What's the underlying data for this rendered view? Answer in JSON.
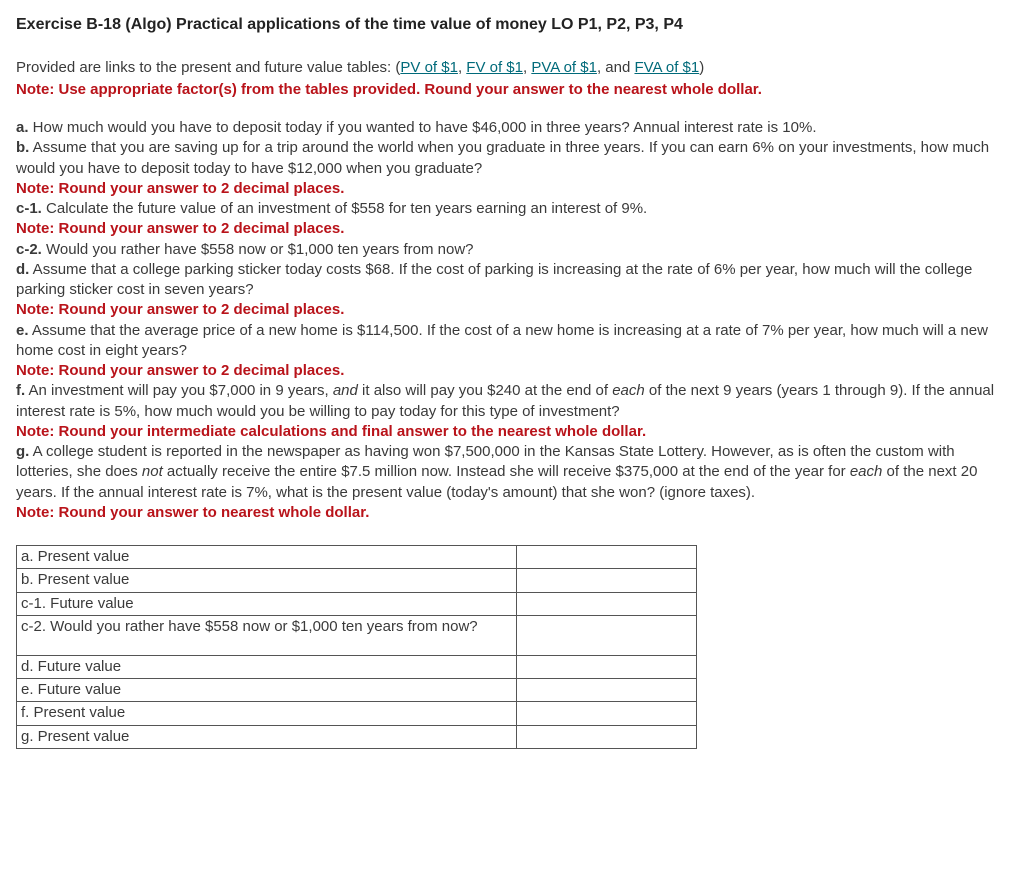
{
  "title": "Exercise B-18 (Algo) Practical applications of the time value of money LO P1, P2, P3, P4",
  "intro": {
    "lead": "Provided are links to the present and future value tables: (",
    "links": {
      "pv": "PV of $1",
      "fv": "FV of $1",
      "pva": "PVA of $1",
      "fva": "FVA of $1"
    },
    "tail": ")"
  },
  "main_note": "Note: Use appropriate factor(s) from the tables provided. Round your answer to the nearest whole dollar.",
  "questions": {
    "a": {
      "label": "a.",
      "text": " How much would you have to deposit today if you wanted to have $46,000 in three years? Annual interest rate is 10%."
    },
    "b": {
      "label": "b.",
      "text": " Assume that you are saving up for a trip around the world when you graduate in three years. If you can earn 6% on your investments, how much would you have to deposit today to have $12,000 when you graduate?",
      "note": "Note: Round your answer to 2 decimal places."
    },
    "c1": {
      "label": "c-1.",
      "text": " Calculate the future value of an investment of $558 for ten years earning an interest of 9%.",
      "note": "Note: Round your answer to 2 decimal places."
    },
    "c2": {
      "label": "c-2.",
      "text": " Would you rather have $558 now or $1,000 ten years from now?"
    },
    "d": {
      "label": "d.",
      "text": " Assume that a college parking sticker today costs $68. If the cost of parking is increasing at the rate of 6% per year, how much will the college parking sticker cost in seven years?",
      "note": "Note: Round your answer to 2 decimal places."
    },
    "e": {
      "label": "e.",
      "text": " Assume that the average price of a new home is $114,500. If the cost of a new home is increasing at a rate of 7% per year, how much will a new home cost in eight years?",
      "note": "Note: Round your answer to 2 decimal places."
    },
    "f": {
      "label": "f.",
      "text_a": " An investment will pay you $7,000 in 9 years, ",
      "em1": "and",
      "text_b": " it also will pay you $240 at the end of ",
      "em2": "each",
      "text_c": " of the next 9 years (years 1 through 9). If the annual interest rate is 5%, how much would you be willing to pay today for this type of investment?",
      "note": "Note: Round your intermediate calculations and final answer to the nearest whole dollar."
    },
    "g": {
      "label": "g.",
      "text_a": " A college student is reported in the newspaper as having won $7,500,000 in the Kansas State Lottery. However, as is often the custom with lotteries, she does ",
      "em1": "not",
      "text_b": " actually receive the entire $7.5 million now. Instead she will receive $375,000 at the end of the year for ",
      "em2": "each",
      "text_c": " of the next 20 years. If the annual interest rate is 7%, what is the present value (today's amount) that she won? (ignore taxes).",
      "note": "Note: Round your answer to nearest whole dollar."
    }
  },
  "table": {
    "rows": {
      "a": "a. Present value",
      "b": "b. Present value",
      "c1": "c-1. Future value",
      "c2": "c-2. Would you rather have $558 now or $1,000 ten years from now?",
      "d": "d. Future value",
      "e": "e. Future value",
      "f": "f. Present value",
      "g": "g. Present value"
    }
  }
}
